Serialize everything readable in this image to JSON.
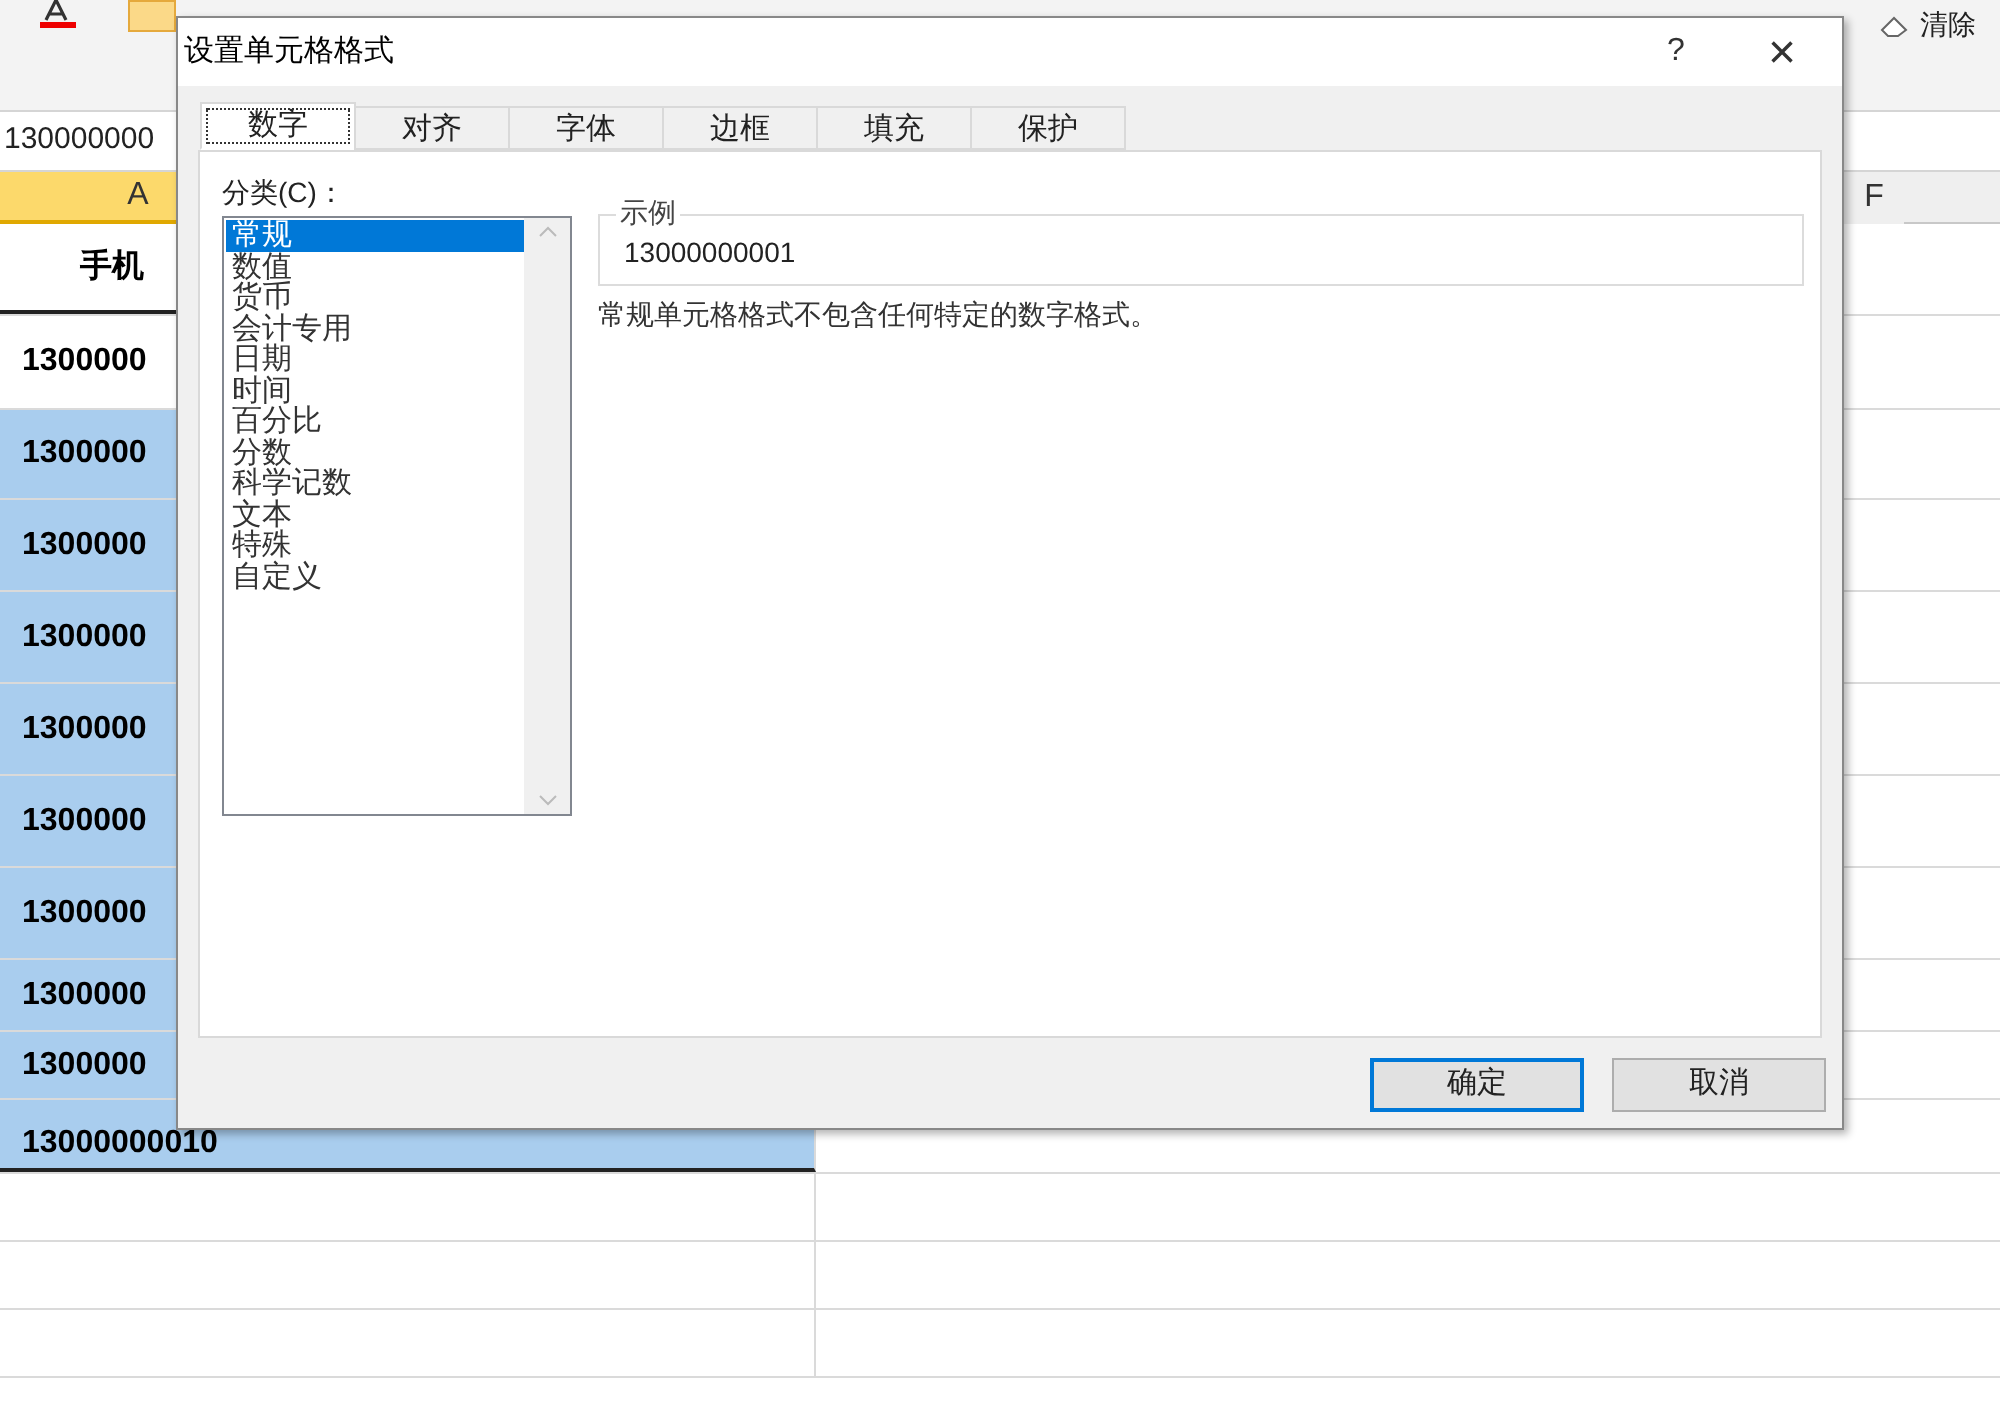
{
  "ribbon": {
    "clear_button": "清除"
  },
  "formula_bar": {
    "value": "130000000"
  },
  "sheet": {
    "columns": [
      {
        "label": "A",
        "selected": true
      },
      {
        "label": "F",
        "selected": false
      }
    ],
    "rows": [
      {
        "value": "手机",
        "kind": "header",
        "selected": false
      },
      {
        "value": "1300000",
        "kind": "cell",
        "selected": false
      },
      {
        "value": "1300000",
        "kind": "cell",
        "selected": true
      },
      {
        "value": "1300000",
        "kind": "cell",
        "selected": true
      },
      {
        "value": "1300000",
        "kind": "cell",
        "selected": true
      },
      {
        "value": "1300000",
        "kind": "cell",
        "selected": true
      },
      {
        "value": "1300000",
        "kind": "cell",
        "selected": true
      },
      {
        "value": "1300000",
        "kind": "cell",
        "selected": true
      },
      {
        "value": "1300000",
        "kind": "cell",
        "selected": true
      },
      {
        "value": "1300000",
        "kind": "cell",
        "selected": true
      },
      {
        "value": "13000000010",
        "kind": "cell",
        "selected": true
      }
    ]
  },
  "dialog": {
    "title": "设置单元格格式",
    "help": "?",
    "close": "×",
    "tabs": [
      {
        "label": "数字",
        "selected": true
      },
      {
        "label": "对齐",
        "selected": false
      },
      {
        "label": "字体",
        "selected": false
      },
      {
        "label": "边框",
        "selected": false
      },
      {
        "label": "填充",
        "selected": false
      },
      {
        "label": "保护",
        "selected": false
      }
    ],
    "category_label": "分类(C)：",
    "categories": [
      {
        "label": "常规",
        "selected": true
      },
      {
        "label": "数值",
        "selected": false
      },
      {
        "label": "货币",
        "selected": false
      },
      {
        "label": "会计专用",
        "selected": false
      },
      {
        "label": "日期",
        "selected": false
      },
      {
        "label": "时间",
        "selected": false
      },
      {
        "label": "百分比",
        "selected": false
      },
      {
        "label": "分数",
        "selected": false
      },
      {
        "label": "科学记数",
        "selected": false
      },
      {
        "label": "文本",
        "selected": false
      },
      {
        "label": "特殊",
        "selected": false
      },
      {
        "label": "自定义",
        "selected": false
      }
    ],
    "sample_label": "示例",
    "sample_value": "13000000001",
    "description": "常规单元格格式不包含任何特定的数字格式。",
    "buttons": [
      {
        "label": "确定",
        "selected": true
      },
      {
        "label": "取消",
        "selected": false
      }
    ]
  }
}
